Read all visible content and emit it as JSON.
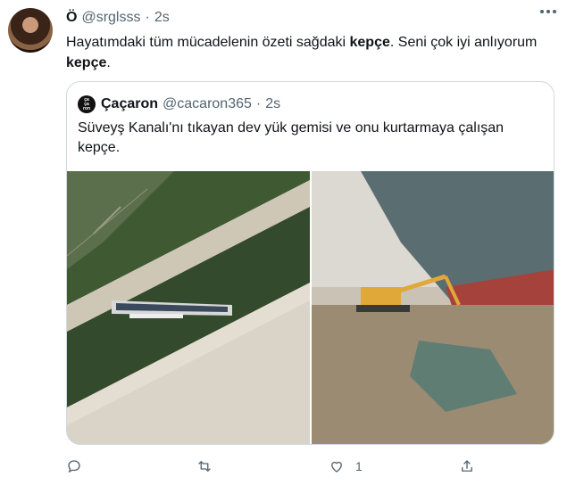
{
  "tweet": {
    "display_name": "Ö",
    "handle": "@srglsss",
    "separator": "·",
    "time": "2s",
    "text_before": "Hayatımdaki tüm mücadelenin özeti sağdaki ",
    "text_bold_1": "kepçe",
    "text_middle": ". Seni çok iyi anlıyorum ",
    "text_bold_2": "kepçe",
    "text_after": "."
  },
  "quote": {
    "avatar_text": "ça\nça\nron",
    "display_name": "Çaçaron",
    "handle": "@cacaron365",
    "separator": "·",
    "time": "2s",
    "text": "Süveyş Kanalı'nı tıkayan dev yük gemisi ve onu kurtarmaya çalışan kepçe."
  },
  "actions": {
    "reply_icon": "reply-icon",
    "retweet_icon": "retweet-icon",
    "like_icon": "heart-icon",
    "like_count": "1",
    "share_icon": "share-icon"
  },
  "colors": {
    "text_primary": "#0f1419",
    "text_secondary": "#536471",
    "border": "#cfd9de"
  }
}
